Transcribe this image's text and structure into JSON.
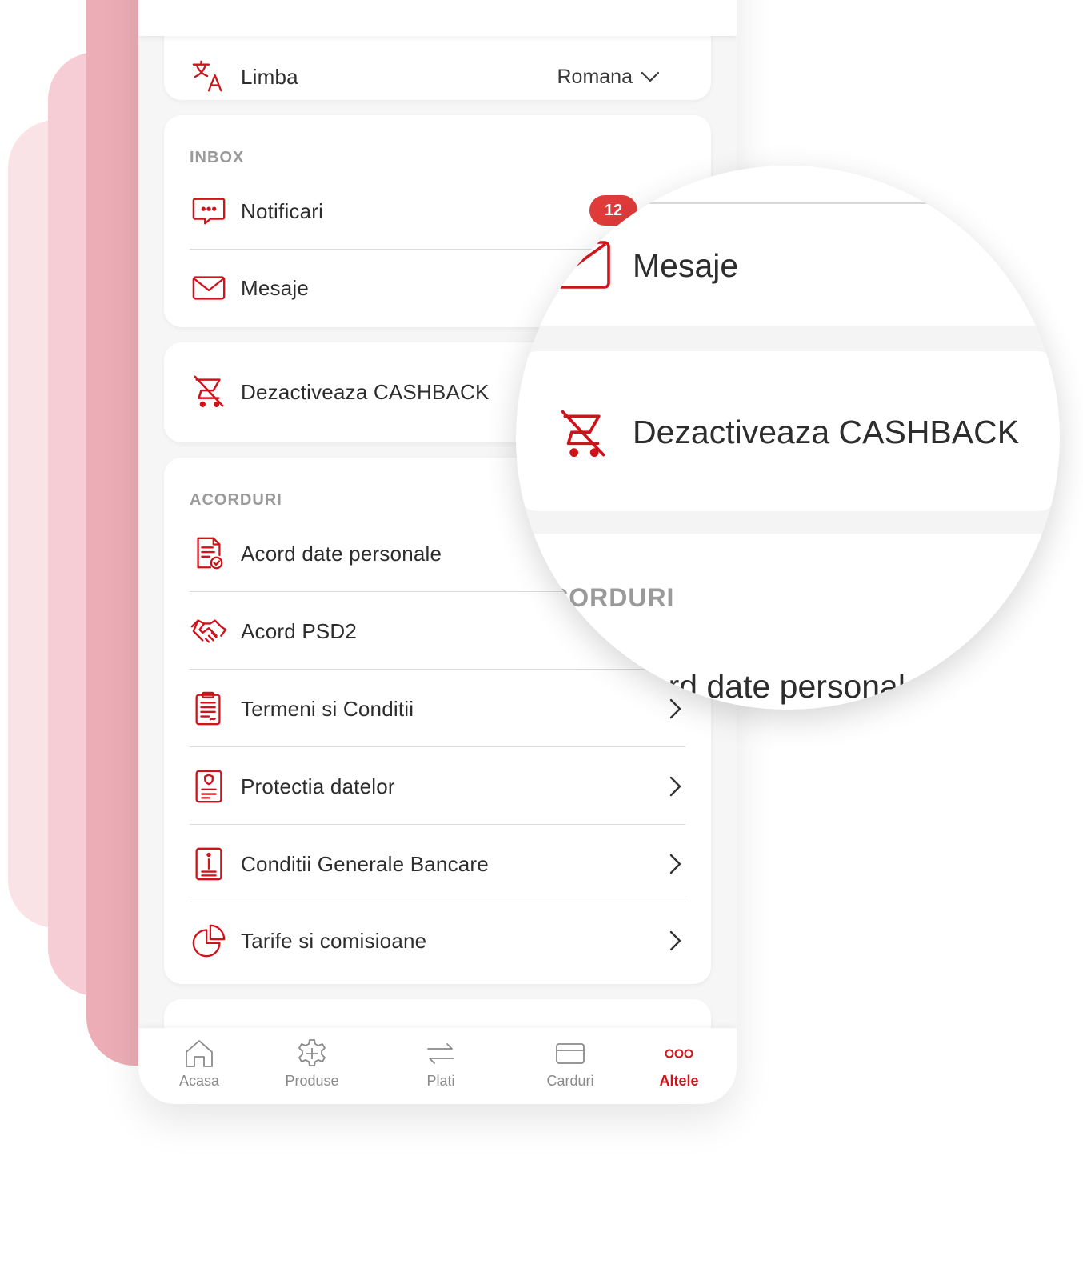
{
  "colors": {
    "accent": "#d0121b",
    "badge": "#e03b3b",
    "section_title": "#9a9a9a",
    "deco_light": "#fae3e7",
    "deco_mid": "#f6cdd4",
    "deco_dark": "#ecadb6"
  },
  "language": {
    "icon": "translate-icon",
    "label": "Limba",
    "value": "Romana"
  },
  "inbox": {
    "title": "INBOX",
    "items": [
      {
        "icon": "chat-bubble-icon",
        "label": "Notificari",
        "badge": "12"
      },
      {
        "icon": "envelope-icon",
        "label": "Mesaje"
      }
    ]
  },
  "cashback": {
    "icon": "cart-off-icon",
    "label": "Dezactiveaza CASHBACK"
  },
  "acorduri": {
    "title": "ACORDURI",
    "items": [
      {
        "icon": "document-check-icon",
        "label": "Acord date personale"
      },
      {
        "icon": "handshake-icon",
        "label": "Acord PSD2"
      },
      {
        "icon": "clipboard-icon",
        "label": "Termeni si Conditii"
      },
      {
        "icon": "shield-document-icon",
        "label": "Protectia datelor"
      },
      {
        "icon": "info-document-icon",
        "label": "Conditii Generale Bancare"
      },
      {
        "icon": "pie-chart-icon",
        "label": "Tarife si comisioane"
      }
    ]
  },
  "bottom_nav": [
    {
      "icon": "home-icon",
      "label": "Acasa"
    },
    {
      "icon": "gear-plus-icon",
      "label": "Produse"
    },
    {
      "icon": "transfer-arrows-icon",
      "label": "Plati"
    },
    {
      "icon": "card-icon",
      "label": "Carduri"
    },
    {
      "icon": "more-dots-icon",
      "label": "Altele",
      "active": true
    }
  ],
  "magnifier": {
    "mesaje": "Mesaje",
    "cashback": "Dezactiveaza CASHBACK",
    "section": "ACORDURI",
    "partial": "Acord date personale"
  }
}
